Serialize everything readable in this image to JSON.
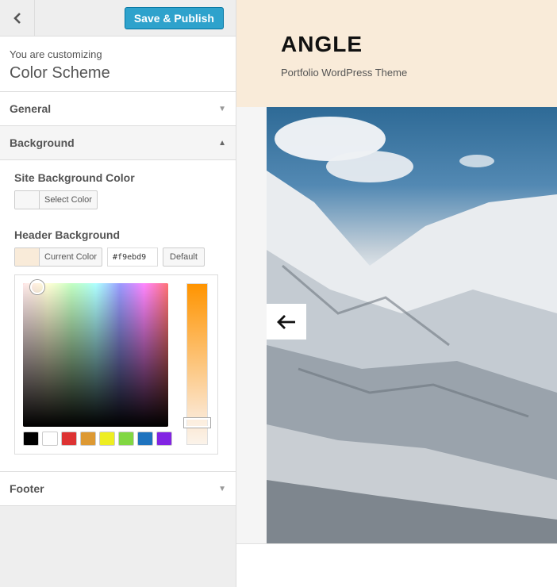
{
  "topbar": {
    "publish_label": "Save & Publish"
  },
  "info": {
    "prefix": "You are customizing",
    "title": "Color Scheme"
  },
  "sections": {
    "general": "General",
    "background": "Background",
    "footer": "Footer"
  },
  "controls": {
    "site_bg": {
      "title": "Site Background Color",
      "button": "Select Color"
    },
    "header_bg": {
      "title": "Header Background",
      "button": "Current Color",
      "value": "#f9ebd9",
      "default_label": "Default"
    }
  },
  "palette_colors": [
    "#000000",
    "#ffffff",
    "#dd3333",
    "#dd9933",
    "#eeee22",
    "#81d742",
    "#1e73be",
    "#8224e3"
  ],
  "preview": {
    "site_title": "ANGLE",
    "tagline": "Portfolio WordPress Theme"
  },
  "colors": {
    "header_bg": "#f9ebd9",
    "publish": "#2ea2cc",
    "accent_strip": "#ff9400"
  }
}
